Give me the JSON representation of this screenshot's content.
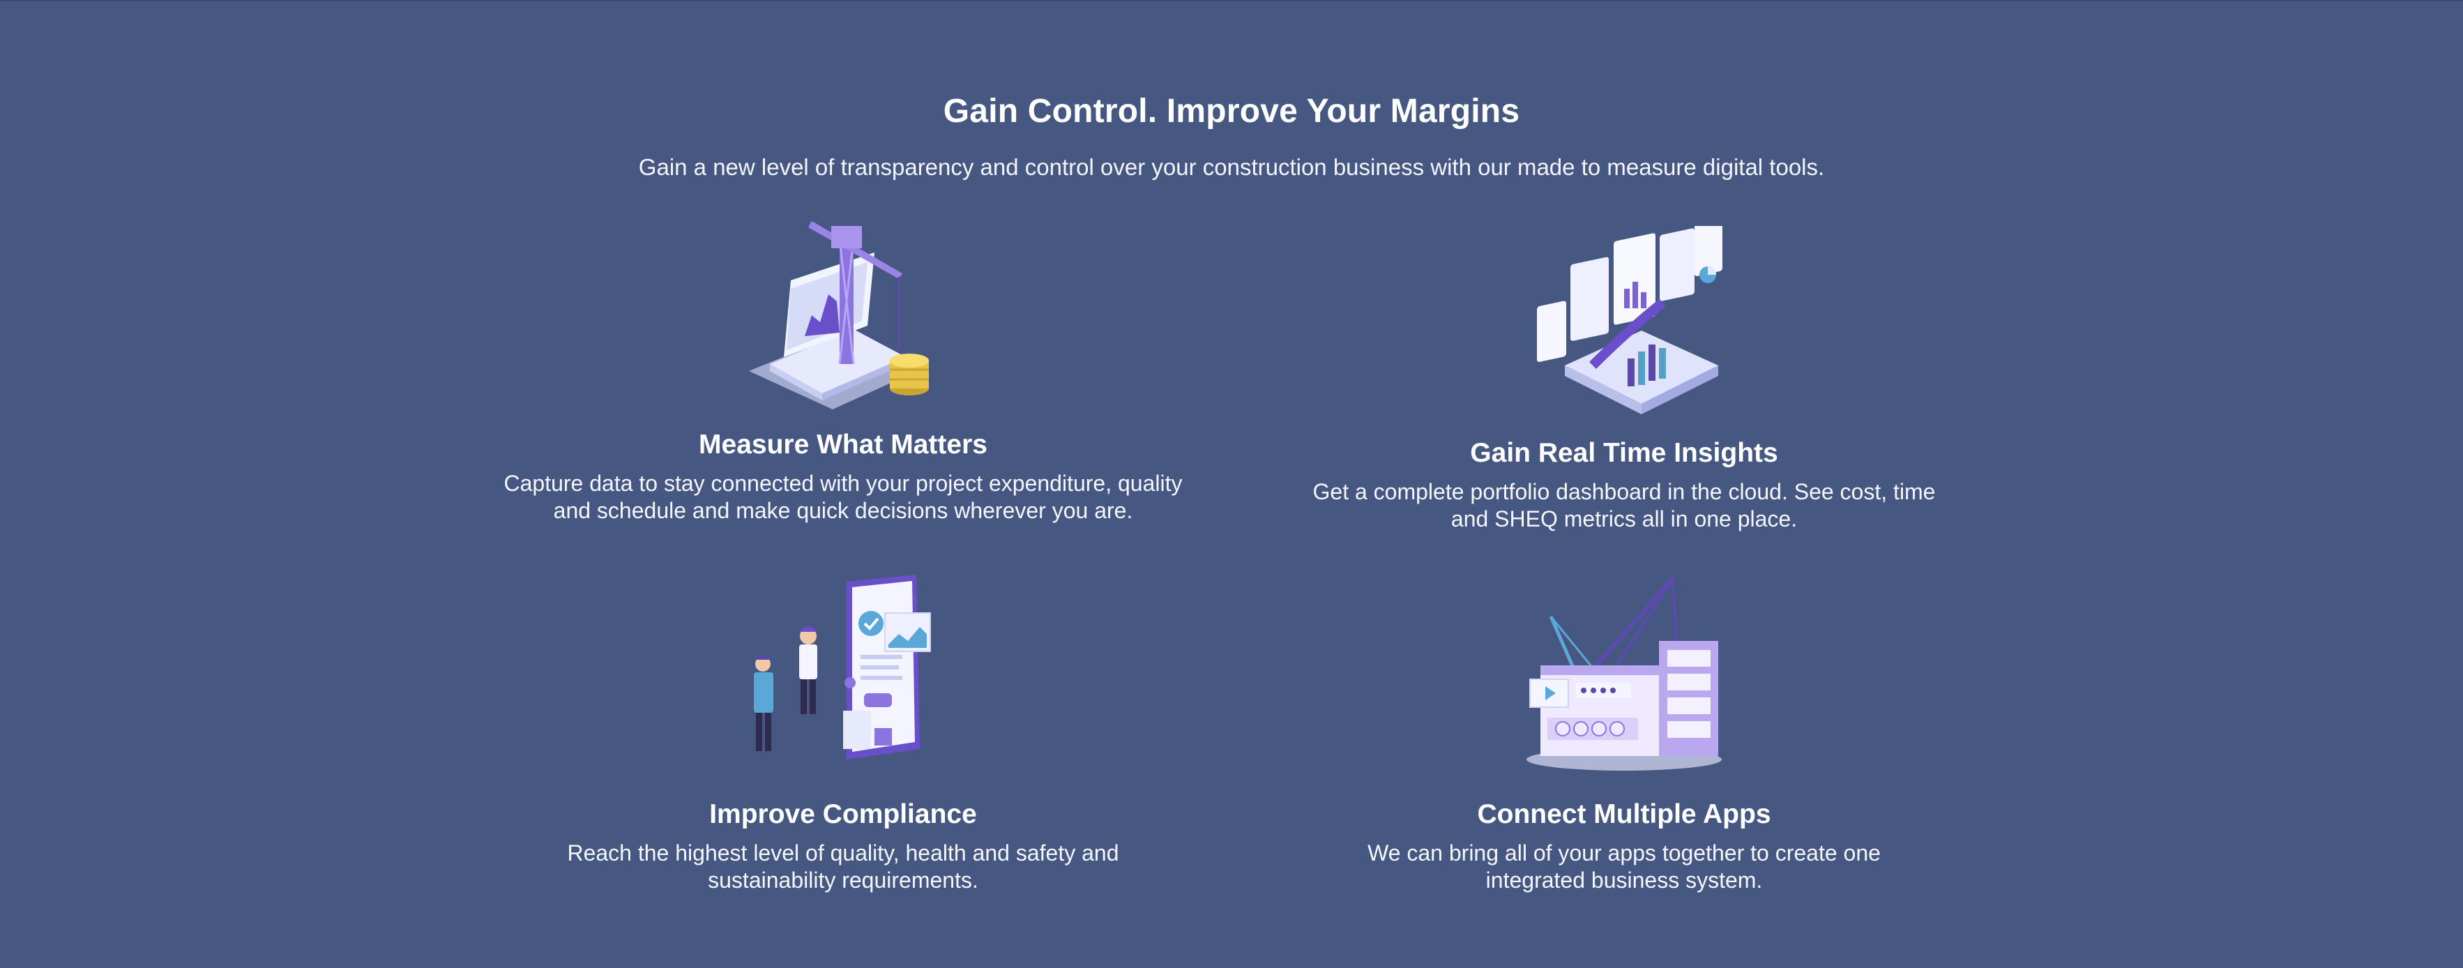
{
  "section": {
    "title": "Gain Control. Improve Your Margins",
    "subtitle": "Gain a new level of transparency and control over your construction business with our made to measure digital tools."
  },
  "features": [
    {
      "icon": "construction-crane-laptop-illustration",
      "title": "Measure What Matters",
      "description": "Capture data to stay connected with your project expenditure, quality and schedule and make quick decisions wherever you are."
    },
    {
      "icon": "dashboard-charts-illustration",
      "title": "Gain Real Time Insights",
      "description": "Get a complete portfolio dashboard in the cloud. See cost, time and SHEQ metrics all in one place."
    },
    {
      "icon": "compliance-checklist-illustration",
      "title": "Improve Compliance",
      "description": "Reach the highest level of quality, health and safety and sustainability requirements."
    },
    {
      "icon": "connected-apps-illustration",
      "title": "Connect Multiple Apps",
      "description": "We can bring all of your apps together to create one integrated business system."
    }
  ],
  "colors": {
    "background": "#465882",
    "text": "#ffffff",
    "illustration_purple": "#7b63d6",
    "illustration_light": "#dfe3fb",
    "illustration_gold": "#e8c54a"
  }
}
